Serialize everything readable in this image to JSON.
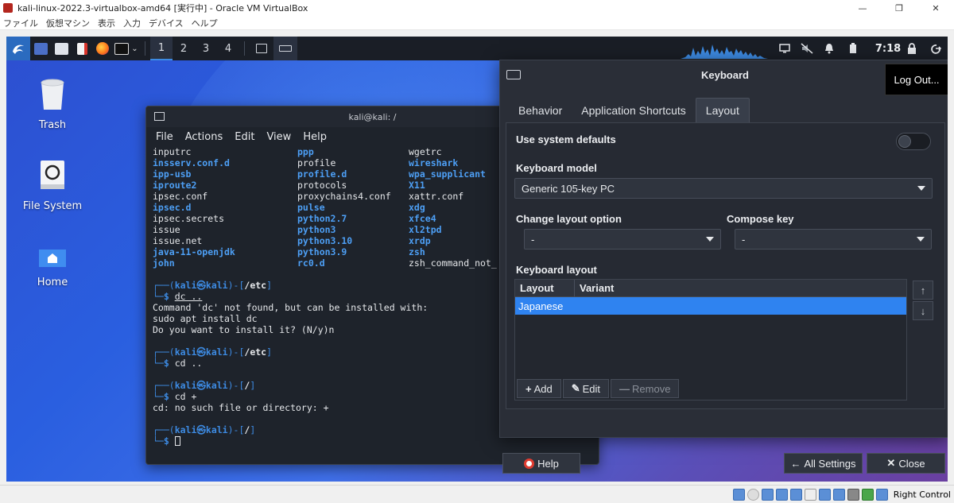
{
  "host": {
    "title": "kali-linux-2022.3-virtualbox-amd64 [実行中] - Oracle VM VirtualBox",
    "menu": [
      "ファイル",
      "仮想マシン",
      "表示",
      "入力",
      "デバイス",
      "ヘルプ"
    ],
    "window_controls": [
      "—",
      "❐",
      "✕"
    ],
    "status_host_key": "Right Control"
  },
  "panel": {
    "workspaces": [
      "1",
      "2",
      "3",
      "4"
    ],
    "active_workspace": "1",
    "clock": "7:18"
  },
  "desktop": {
    "icons": [
      {
        "label": "Trash"
      },
      {
        "label": "File System"
      },
      {
        "label": "Home"
      }
    ]
  },
  "terminal": {
    "title": "kali@kali: /",
    "menu": [
      "File",
      "Actions",
      "Edit",
      "View",
      "Help"
    ],
    "listing": [
      [
        {
          "t": "inputrc",
          "d": false
        },
        {
          "t": "ppp",
          "d": true
        },
        {
          "t": "wgetrc",
          "d": false
        }
      ],
      [
        {
          "t": "insserv.conf.d",
          "d": true
        },
        {
          "t": "profile",
          "d": false
        },
        {
          "t": "wireshark",
          "d": true
        }
      ],
      [
        {
          "t": "ipp-usb",
          "d": true
        },
        {
          "t": "profile.d",
          "d": true
        },
        {
          "t": "wpa_supplicant",
          "d": true
        }
      ],
      [
        {
          "t": "iproute2",
          "d": true
        },
        {
          "t": "protocols",
          "d": false
        },
        {
          "t": "X11",
          "d": true
        }
      ],
      [
        {
          "t": "ipsec.conf",
          "d": false
        },
        {
          "t": "proxychains4.conf",
          "d": false
        },
        {
          "t": "xattr.conf",
          "d": false
        }
      ],
      [
        {
          "t": "ipsec.d",
          "d": true
        },
        {
          "t": "pulse",
          "d": true
        },
        {
          "t": "xdg",
          "d": true
        }
      ],
      [
        {
          "t": "ipsec.secrets",
          "d": false
        },
        {
          "t": "python2.7",
          "d": true
        },
        {
          "t": "xfce4",
          "d": true
        }
      ],
      [
        {
          "t": "issue",
          "d": false
        },
        {
          "t": "python3",
          "d": true
        },
        {
          "t": "xl2tpd",
          "d": true
        }
      ],
      [
        {
          "t": "issue.net",
          "d": false
        },
        {
          "t": "python3.10",
          "d": true
        },
        {
          "t": "xrdp",
          "d": true
        }
      ],
      [
        {
          "t": "java-11-openjdk",
          "d": true
        },
        {
          "t": "python3.9",
          "d": true
        },
        {
          "t": "zsh",
          "d": true
        }
      ],
      [
        {
          "t": "john",
          "d": true
        },
        {
          "t": "rc0.d",
          "d": true
        },
        {
          "t": "zsh_command_not_",
          "d": false
        }
      ]
    ],
    "session": [
      {
        "prompt": {
          "user": "kali",
          "host": "kali",
          "path": "/etc"
        },
        "cmd": "dc ..",
        "underline": true,
        "output": [
          "Command 'dc' not found, but can be installed with:",
          "sudo apt install dc",
          "Do you want to install it? (N/y)n"
        ]
      },
      {
        "prompt": {
          "user": "kali",
          "host": "kali",
          "path": "/etc"
        },
        "cmd": "cd ..",
        "underline": false,
        "output": []
      },
      {
        "prompt": {
          "user": "kali",
          "host": "kali",
          "path": "/"
        },
        "cmd": "cd +",
        "underline": false,
        "output": [
          "cd: no such file or directory: +"
        ]
      },
      {
        "prompt": {
          "user": "kali",
          "host": "kali",
          "path": "/"
        },
        "cmd": "",
        "underline": false,
        "output": [],
        "cursor": true
      }
    ]
  },
  "keyboard_dialog": {
    "title": "Keyboard",
    "tooltip": "Log Out...",
    "tabs": [
      "Behavior",
      "Application Shortcuts",
      "Layout"
    ],
    "active_tab": "Layout",
    "use_system_defaults_label": "Use system defaults",
    "use_system_defaults": false,
    "keyboard_model_label": "Keyboard model",
    "keyboard_model_value": "Generic 105-key PC",
    "change_layout_label": "Change layout option",
    "change_layout_value": "-",
    "compose_key_label": "Compose key",
    "compose_key_value": "-",
    "keyboard_layout_label": "Keyboard layout",
    "columns": [
      "Layout",
      "Variant"
    ],
    "rows": [
      {
        "layout": "Japanese",
        "variant": ""
      }
    ],
    "add_label": "Add",
    "edit_label": "Edit",
    "remove_label": "Remove",
    "help_label": "Help",
    "all_settings_label": "All Settings",
    "close_label": "Close"
  }
}
